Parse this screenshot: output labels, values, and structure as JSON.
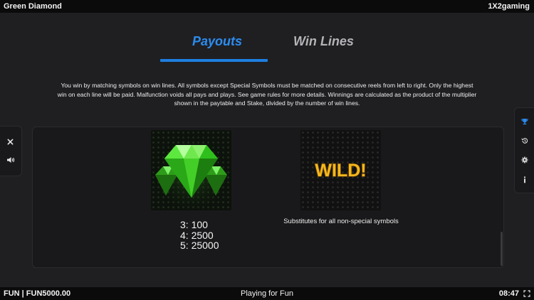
{
  "header": {
    "title": "Green Diamond",
    "brand": "1X2gaming"
  },
  "tabs": [
    {
      "label": "Payouts",
      "active": true
    },
    {
      "label": "Win Lines",
      "active": false
    }
  ],
  "rules_text": "You win by matching symbols on win lines. All symbols except Special Symbols must be matched on consecutive reels from left to right. Only the highest win on each line will be paid. Malfunction voids all pays and plays. See game rules for more details. Winnings are calculated as the product of the multiplier shown in the paytable and Stake, divided by the number of win lines.",
  "symbols": [
    {
      "icon": "green-diamond-icon",
      "payouts": [
        "3: 100",
        "4: 2500",
        "5: 25000"
      ]
    },
    {
      "icon": "wild-icon",
      "label": "WILD!",
      "description": "Substitutes for all non-special symbols"
    }
  ],
  "left_controls": [
    {
      "icon": "close-icon"
    },
    {
      "icon": "sound-icon"
    }
  ],
  "right_controls": [
    {
      "icon": "trophy-icon",
      "active": true
    },
    {
      "icon": "history-icon"
    },
    {
      "icon": "settings-icon"
    },
    {
      "icon": "info-icon"
    }
  ],
  "footer": {
    "balance": "FUN | FUN5000.00",
    "mode": "Playing for Fun",
    "time": "08:47"
  },
  "colors": {
    "accent": "#2c8cf0",
    "background": "#1f1f22",
    "panel": "#19191b",
    "wild_gold": "#f5b71c",
    "gem_green": "#3fd92a"
  }
}
